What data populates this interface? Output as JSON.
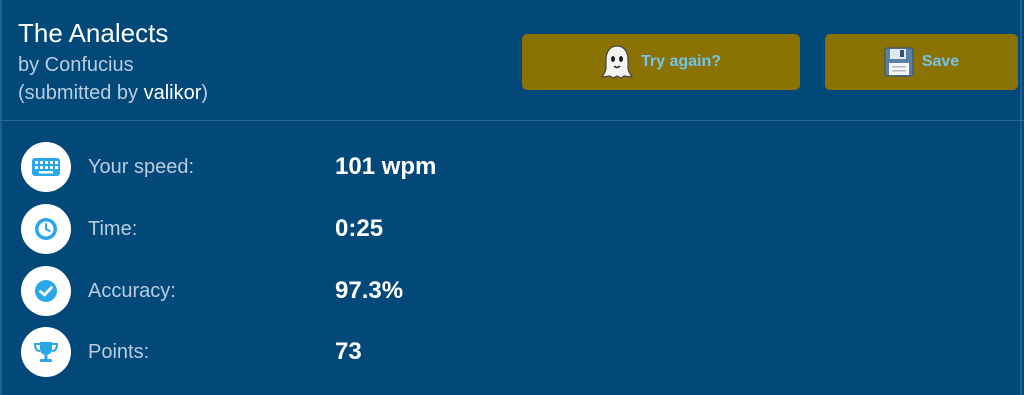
{
  "header": {
    "title": "The Analects",
    "author": "by Confucius",
    "submitted_prefix": "(submitted by ",
    "submitted_user": "valikor",
    "submitted_suffix": ")"
  },
  "buttons": {
    "try_again": {
      "label": "Try again?",
      "icon": "ghost-icon"
    },
    "save": {
      "label": "Save",
      "icon": "floppy-disk-icon"
    }
  },
  "stats": [
    {
      "label": "Your speed:",
      "value": "101 wpm",
      "icon": "keyboard-icon"
    },
    {
      "label": "Time:",
      "value": "0:25",
      "icon": "clock-icon"
    },
    {
      "label": "Accuracy:",
      "value": "97.3%",
      "icon": "checkmark-icon"
    },
    {
      "label": "Points:",
      "value": "73",
      "icon": "trophy-icon"
    }
  ],
  "colors": {
    "background": "#024878",
    "button": "#8a7205",
    "button_text": "#74c3ea",
    "icon_accent": "#2aa7e8"
  }
}
